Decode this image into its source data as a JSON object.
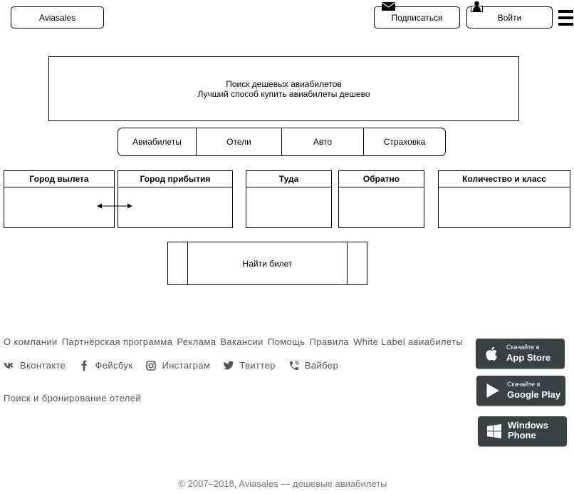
{
  "header": {
    "logo_label": "Aviasales",
    "subscribe_label": "Подписаться",
    "login_label": "Войти"
  },
  "hero": {
    "title": "Поиск дешевых авиабилетов",
    "subtitle": "Лучший способ купить авиабилеты дешево"
  },
  "tabs": [
    {
      "label": "Авиабилеты"
    },
    {
      "label": "Отели"
    },
    {
      "label": "Авто"
    },
    {
      "label": "Страховка"
    }
  ],
  "search": {
    "fields": [
      {
        "label": "Город вылета"
      },
      {
        "label": "Город прибытия"
      },
      {
        "label": "Туда"
      },
      {
        "label": "Обратно"
      },
      {
        "label": "Количество и класс"
      }
    ],
    "submit_label": "Найти билет"
  },
  "footer": {
    "links": [
      "О компании",
      "Партнёрская программа",
      "Реклама",
      "Вакансии",
      "Помощь",
      "Правила",
      "White Label авиабилеты"
    ],
    "social": [
      {
        "label": "Вконтакте",
        "icon": "vk-icon"
      },
      {
        "label": "Фейсбук",
        "icon": "facebook-icon"
      },
      {
        "label": "Инстаграм",
        "icon": "instagram-icon"
      },
      {
        "label": "Твиттер",
        "icon": "twitter-icon"
      },
      {
        "label": "Вайбер",
        "icon": "viber-icon"
      }
    ],
    "hotels_link": "Поиск и бронирование отелей",
    "apps": {
      "app_store": {
        "caption": "Скачайте в",
        "store": "App Store",
        "icon": "apple-icon"
      },
      "google_play": {
        "caption": "Скачайте в",
        "store": "Google Play",
        "icon": "google-play-icon"
      },
      "windows_phone": {
        "line1": "Windows",
        "line2": "Phone",
        "icon": "windows-icon"
      }
    },
    "copyright": "© 2007–2018, Aviasales — дешевые авиабилеты"
  },
  "icons": {
    "subscribe": "envelope-icon",
    "login": "user-icon",
    "menu": "hamburger-menu-icon",
    "swap": "swap-arrows-icon"
  },
  "colors": {
    "wireframe_line": "#000000",
    "footer_text": "#555555",
    "copyright_text": "#777777",
    "badge_background": "#394143",
    "badge_text": "#ffffff"
  }
}
